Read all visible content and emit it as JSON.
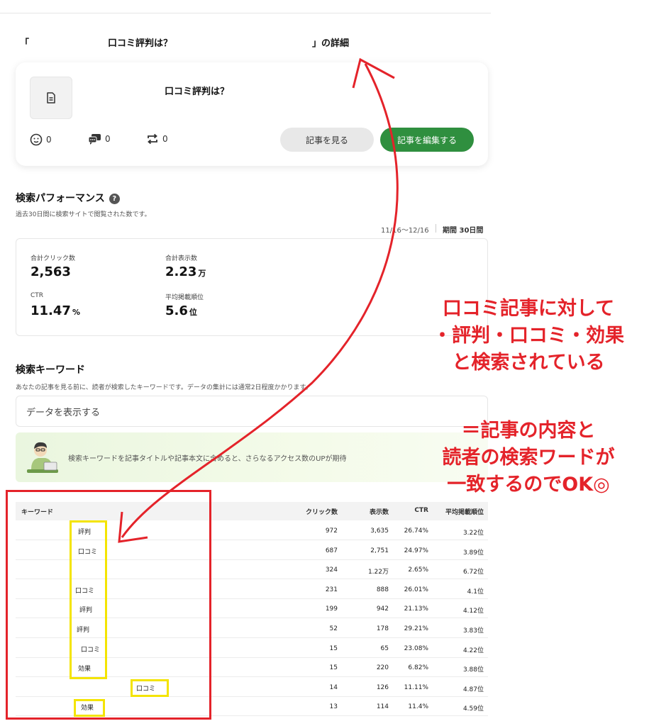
{
  "detail": {
    "open_quote": "「",
    "title_fragment": "口コミ評判は？",
    "close_suffix": "」の詳細"
  },
  "article_card": {
    "title": "口コミ評判は？",
    "stats": [
      {
        "icon": "reaction-icon",
        "value": "0"
      },
      {
        "icon": "comment-icon",
        "value": "0"
      },
      {
        "icon": "repost-icon",
        "value": "0"
      }
    ],
    "view_button": "記事を見る",
    "edit_button": "記事を編集する",
    "colors": {
      "edit_button": "#2f8f3f"
    }
  },
  "performance": {
    "title": "検索パフォーマンス",
    "help_icon": "?",
    "subtitle": "過去30日間に検索サイトで閲覧された数です。",
    "date_range": "11/16〜12/16",
    "period_label": "期間 30日間",
    "metrics": [
      {
        "label": "合計クリック数",
        "value": "2,563",
        "unit": ""
      },
      {
        "label": "合計表示数",
        "value": "2.23",
        "unit": "万"
      },
      {
        "label": "CTR",
        "value": "11.47",
        "unit": "%"
      },
      {
        "label": "平均掲載順位",
        "value": "5.6",
        "unit": "位"
      }
    ]
  },
  "keywords": {
    "title": "検索キーワード",
    "subtitle": "あなたの記事を見る前に、読者が検索したキーワードです。データの集計には通常2日程度かかります。",
    "show_data": "データを表示する",
    "tip": "検索キーワードを記事タイトルや記事本文に含めると、さらなるアクセス数のUPが期待",
    "columns": [
      "キーワード",
      "クリック数",
      "表示数",
      "CTR",
      "平均掲載順位"
    ],
    "rows": [
      {
        "keyword": "評判",
        "clicks": "972",
        "impressions": "3,635",
        "ctr": "26.74%",
        "rank": "3.22位"
      },
      {
        "keyword": "口コミ",
        "clicks": "687",
        "impressions": "2,751",
        "ctr": "24.97%",
        "rank": "3.89位"
      },
      {
        "keyword": "",
        "clicks": "324",
        "impressions": "1.22万",
        "ctr": "2.65%",
        "rank": "6.72位"
      },
      {
        "keyword": "口コミ",
        "clicks": "231",
        "impressions": "888",
        "ctr": "26.01%",
        "rank": "4.1位"
      },
      {
        "keyword": "評判",
        "clicks": "199",
        "impressions": "942",
        "ctr": "21.13%",
        "rank": "4.12位"
      },
      {
        "keyword": "評判",
        "clicks": "52",
        "impressions": "178",
        "ctr": "29.21%",
        "rank": "3.83位"
      },
      {
        "keyword": "口コミ",
        "clicks": "15",
        "impressions": "65",
        "ctr": "23.08%",
        "rank": "4.22位"
      },
      {
        "keyword": "効果",
        "clicks": "15",
        "impressions": "220",
        "ctr": "6.82%",
        "rank": "3.88位"
      },
      {
        "keyword": "口コミ",
        "clicks": "14",
        "impressions": "126",
        "ctr": "11.11%",
        "rank": "4.87位"
      },
      {
        "keyword": "効果",
        "clicks": "13",
        "impressions": "114",
        "ctr": "11.4%",
        "rank": "4.59位"
      }
    ]
  },
  "annotation": {
    "callout_line1": "口コミ記事に対して",
    "callout_line2": "・評判・口コミ・効果",
    "callout_line3": "と検索されている",
    "conclusion_line1": "＝記事の内容と",
    "conclusion_line2": "読者の検索ワードが",
    "conclusion_line3": "一致するのでOK◎",
    "colors": {
      "red": "#e4232a",
      "yellow": "#f4e400"
    }
  }
}
